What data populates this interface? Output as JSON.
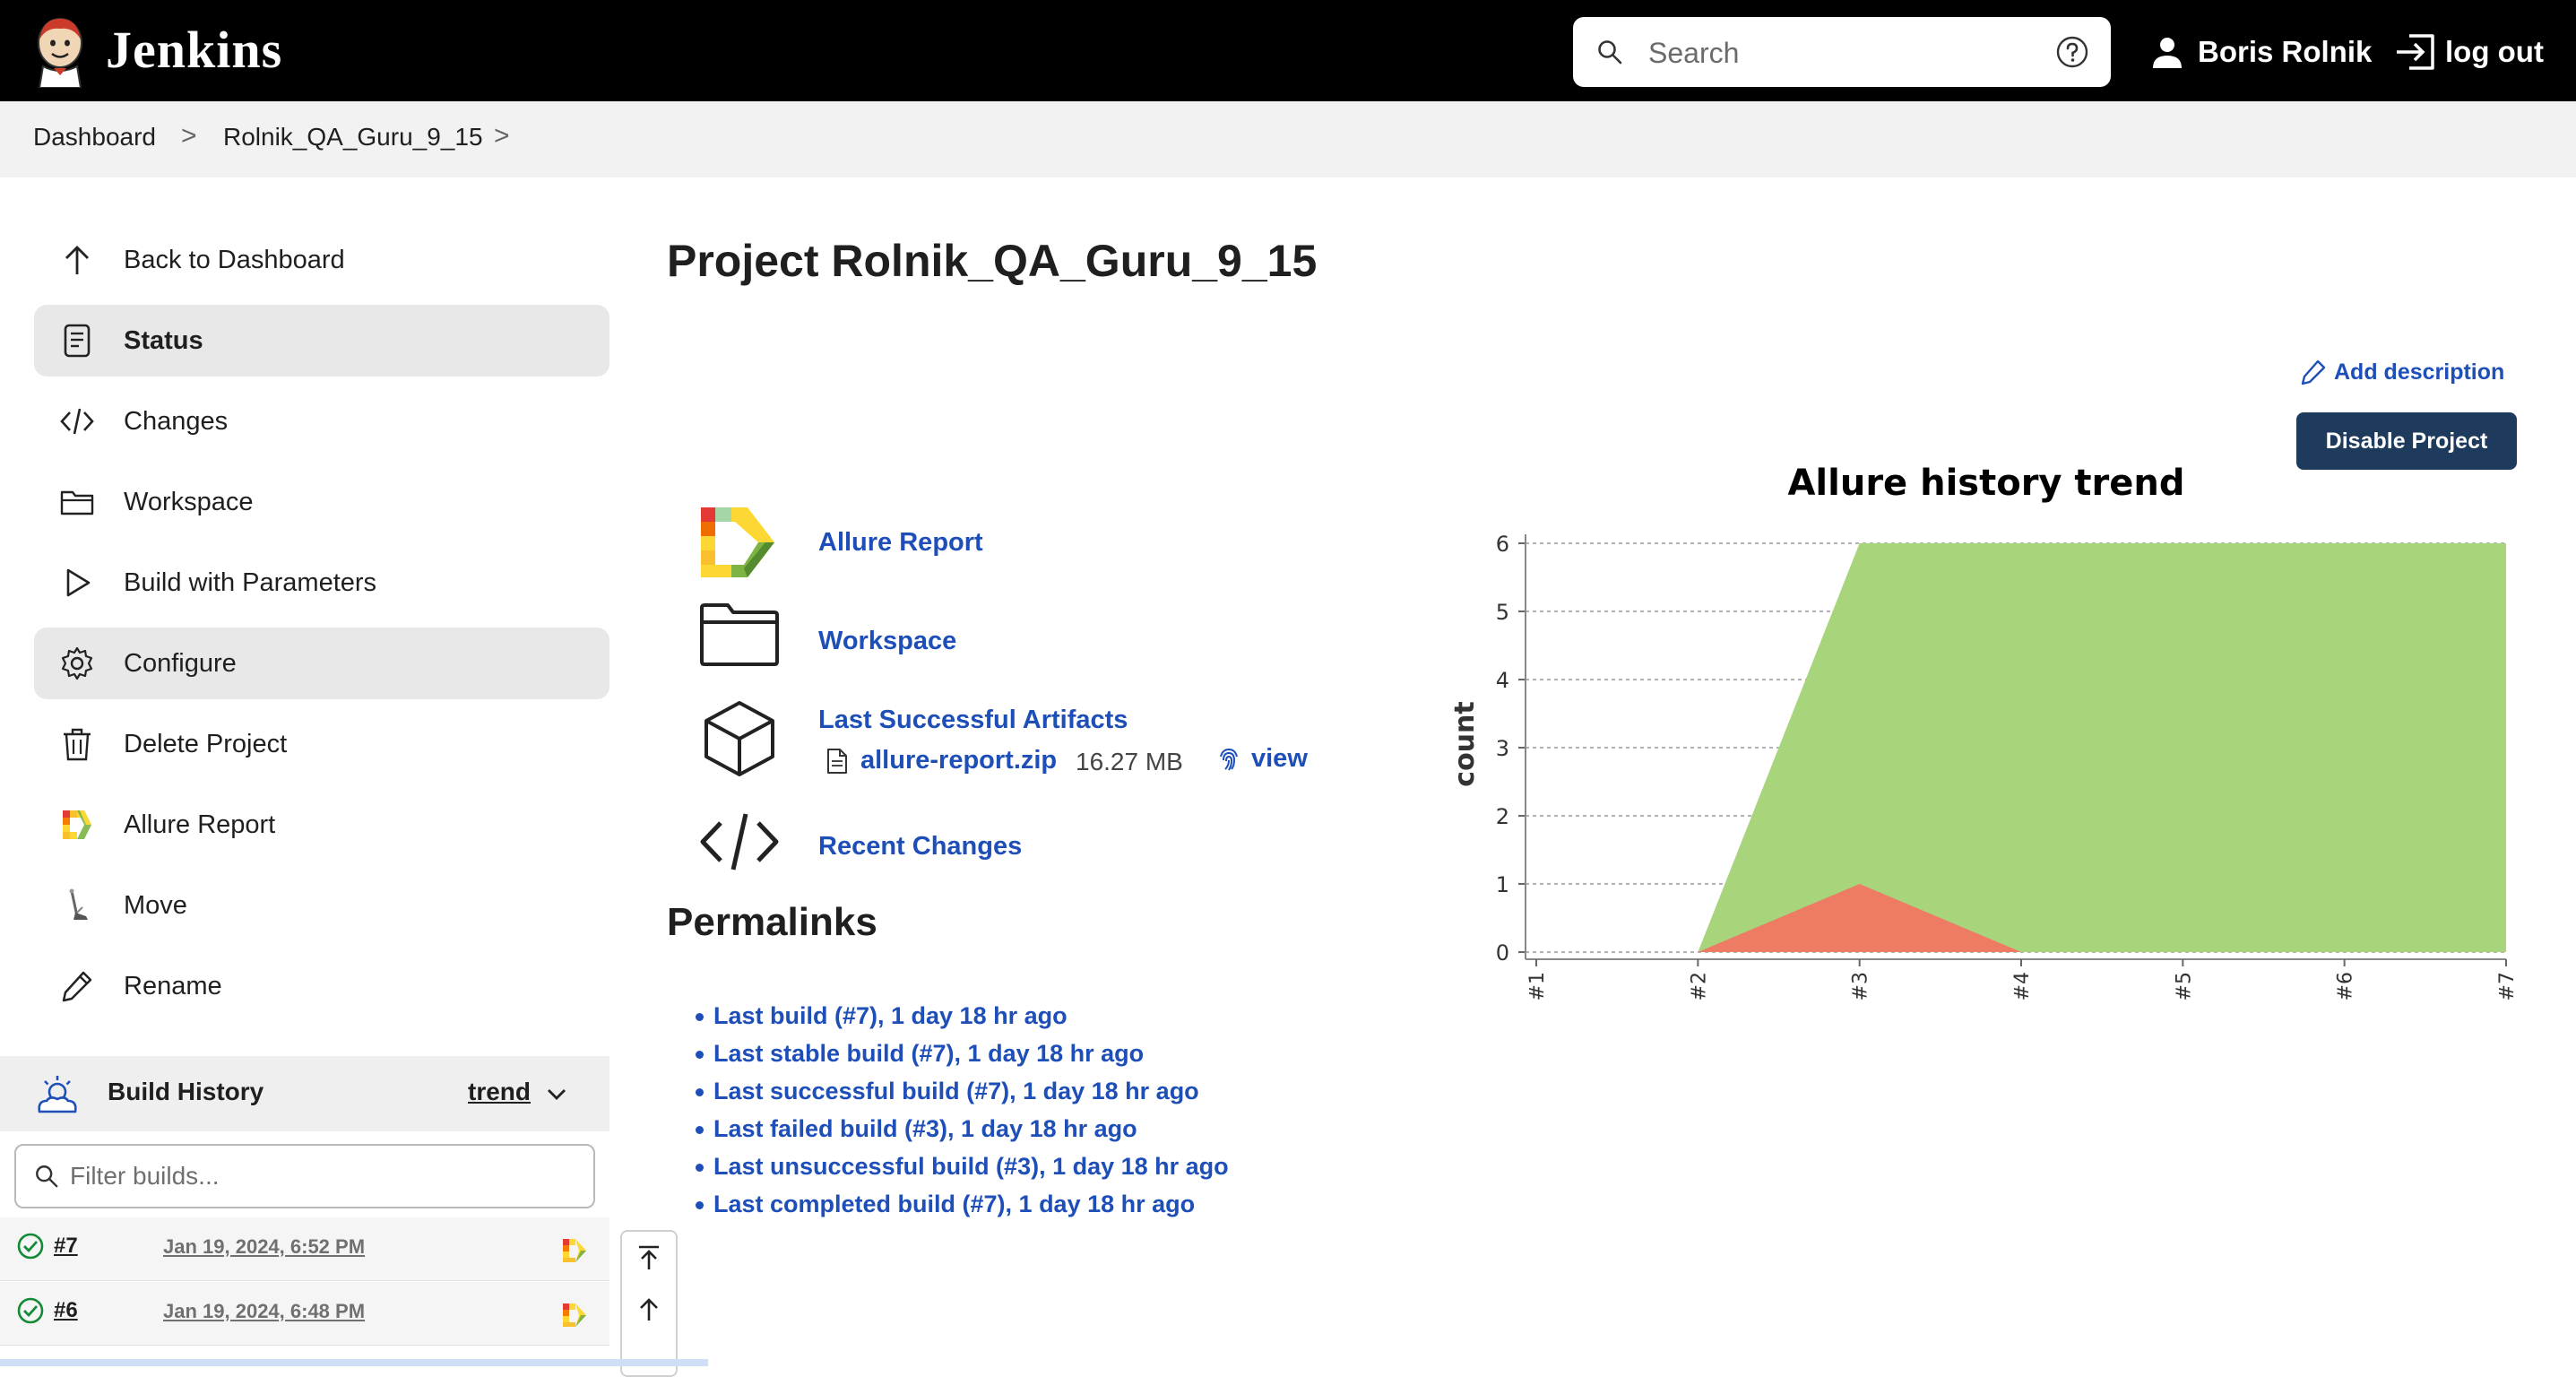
{
  "header": {
    "app_name": "Jenkins",
    "search_placeholder": "Search",
    "user_name": "Boris Rolnik",
    "logout_label": "log out"
  },
  "breadcrumb": {
    "items": [
      "Dashboard",
      "Rolnik_QA_Guru_9_15"
    ],
    "separator": ">"
  },
  "sidebar": {
    "items": [
      {
        "label": "Back to Dashboard",
        "icon": "arrow-up-icon"
      },
      {
        "label": "Status",
        "icon": "document-icon",
        "active": true
      },
      {
        "label": "Changes",
        "icon": "code-icon"
      },
      {
        "label": "Workspace",
        "icon": "folder-icon"
      },
      {
        "label": "Build with Parameters",
        "icon": "play-icon"
      },
      {
        "label": "Configure",
        "icon": "gear-icon",
        "hover": true
      },
      {
        "label": "Delete Project",
        "icon": "trash-icon"
      },
      {
        "label": "Allure Report",
        "icon": "allure-icon"
      },
      {
        "label": "Move",
        "icon": "move-icon"
      },
      {
        "label": "Rename",
        "icon": "pencil-icon"
      }
    ]
  },
  "build_history": {
    "title": "Build History",
    "trend_label": "trend",
    "filter_placeholder": "Filter builds...",
    "builds": [
      {
        "number": "#7",
        "date": "Jan 19, 2024, 6:52 PM",
        "status": "success"
      },
      {
        "number": "#6",
        "date": "Jan 19, 2024, 6:48 PM",
        "status": "success"
      }
    ]
  },
  "main": {
    "title": "Project Rolnik_QA_Guru_9_15",
    "add_description": "Add description",
    "disable_button": "Disable Project",
    "links": {
      "allure_report": "Allure Report",
      "workspace": "Workspace",
      "last_successful_artifacts": "Last Successful Artifacts",
      "recent_changes": "Recent Changes"
    },
    "artifact": {
      "file_name": "allure-report.zip",
      "size": "16.27 MB",
      "view_label": "view"
    },
    "permalinks_title": "Permalinks",
    "permalinks": [
      "Last build (#7), 1 day 18 hr ago",
      "Last stable build (#7), 1 day 18 hr ago",
      "Last successful build (#7), 1 day 18 hr ago",
      "Last failed build (#3), 1 day 18 hr ago",
      "Last unsuccessful build (#3), 1 day 18 hr ago",
      "Last completed build (#7), 1 day 18 hr ago"
    ]
  },
  "colors": {
    "header_bg": "#000000",
    "link": "#1e4fb8",
    "button_bg": "#1e3a5c",
    "passed": "#a8d47c",
    "failed": "#ee7b63"
  },
  "chart_data": {
    "type": "area",
    "title": "Allure history trend",
    "xlabel": "",
    "ylabel": "count",
    "categories": [
      "#1",
      "#2",
      "#3",
      "#4",
      "#5",
      "#6",
      "#7"
    ],
    "ylim": [
      0,
      6
    ],
    "yticks": [
      0,
      1,
      2,
      3,
      4,
      5,
      6
    ],
    "grid": true,
    "series": [
      {
        "values": [
          0,
          0,
          6,
          6,
          6,
          6,
          6
        ],
        "color": "#a8d47c"
      },
      {
        "values": [
          0,
          0,
          1,
          0,
          0,
          0,
          0
        ],
        "color": "#ee7b63"
      }
    ]
  }
}
